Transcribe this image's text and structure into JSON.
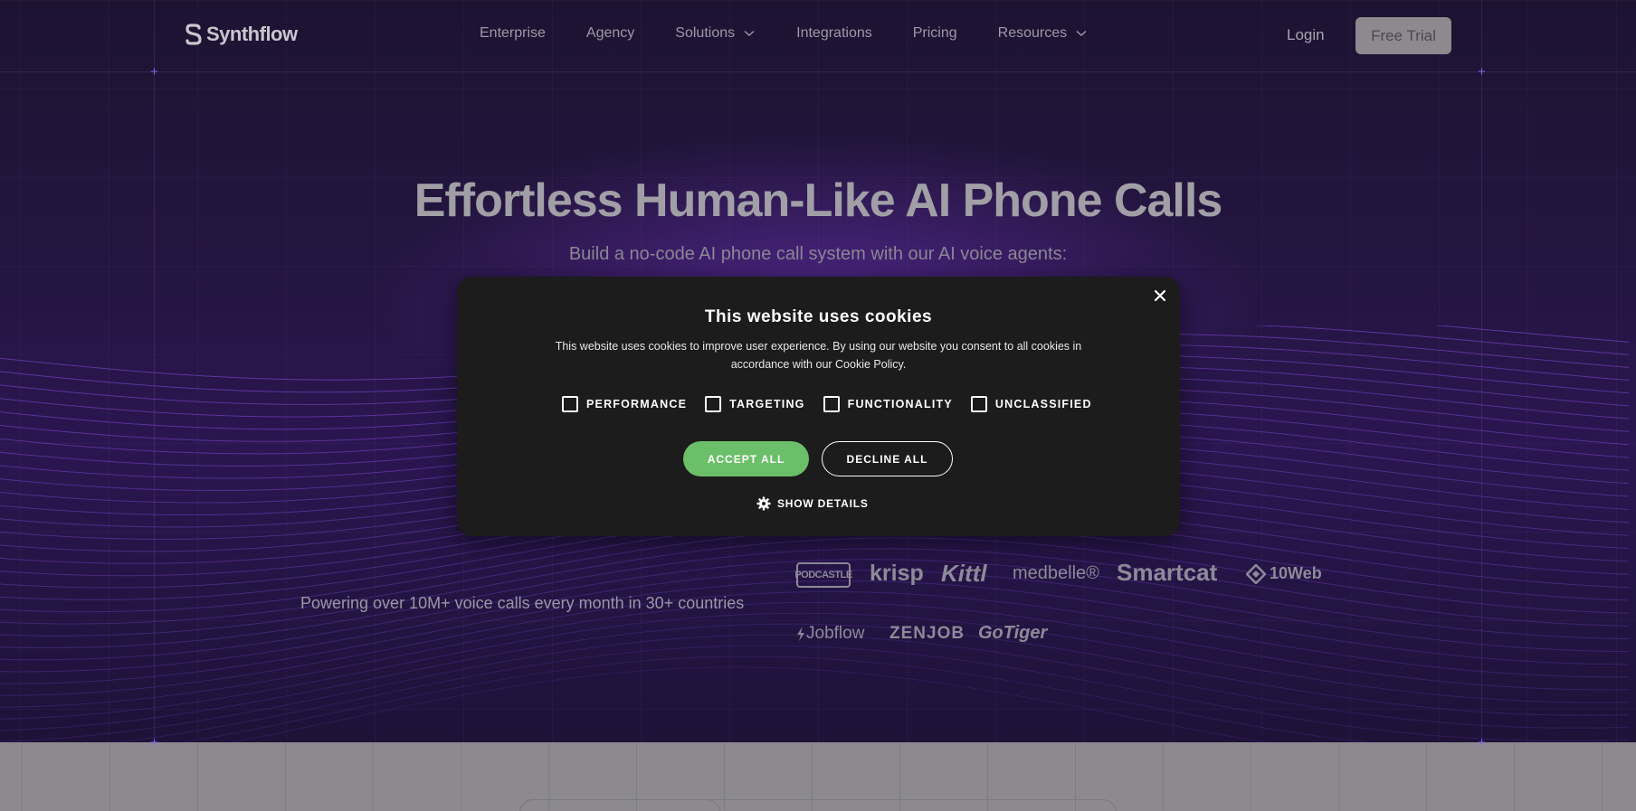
{
  "nav": {
    "logo_text": "Synthflow",
    "links": [
      {
        "label": "Enterprise",
        "has_dropdown": false
      },
      {
        "label": "Agency",
        "has_dropdown": false
      },
      {
        "label": "Solutions",
        "has_dropdown": true
      },
      {
        "label": "Integrations",
        "has_dropdown": false
      },
      {
        "label": "Pricing",
        "has_dropdown": false
      },
      {
        "label": "Resources",
        "has_dropdown": true
      }
    ],
    "login_label": "Login",
    "trial_label": "Free Trial"
  },
  "hero": {
    "headline": "Effortless Human-Like AI Phone Calls",
    "subline": "Build a no-code AI phone call system with our AI voice agents:",
    "powering": "Powering over 10M+ voice calls every month in 30+ countries",
    "brands_row1": [
      "PODCASTLE",
      "krisp",
      "Kittl",
      "medbelle®",
      "Smartcat",
      "10Web"
    ],
    "brands_row2": [
      "Jobflow",
      "ZENJOB",
      "GoTiger"
    ]
  },
  "cookie_modal": {
    "title": "This website uses cookies",
    "body": "This website uses cookies to improve user experience. By using our website you consent to all cookies in accordance with our Cookie Policy.",
    "categories": [
      "PERFORMANCE",
      "TARGETING",
      "FUNCTIONALITY",
      "UNCLASSIFIED"
    ],
    "accept_label": "ACCEPT ALL",
    "decline_label": "DECLINE ALL",
    "details_label": "SHOW DETAILS",
    "close_icon": "close-icon",
    "colors": {
      "accept": "#6bbf69",
      "background": "#1c1c1c"
    }
  },
  "colors": {
    "hero_bg": "#1d1233",
    "accent_purple": "#8a5cf0"
  }
}
